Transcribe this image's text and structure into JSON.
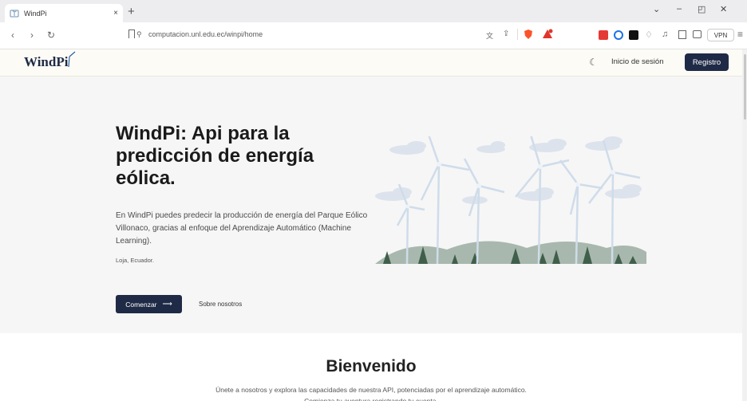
{
  "browser": {
    "tab_title": "WindPi",
    "tab_close": "×",
    "new_tab": "+",
    "url": "computacion.unl.edu.ec/winpi/home",
    "vpn_label": "VPN",
    "window_controls": {
      "dropdown": "⌄",
      "minimize": "–",
      "restore": "◰",
      "close": "✕"
    },
    "nav": {
      "back": "‹",
      "forward": "›",
      "reload": "↻"
    },
    "extension_colors": [
      "#e53935",
      "#1a73e8",
      "#111111"
    ]
  },
  "header": {
    "logo_text": "WindPi",
    "login_label": "Inicio de sesión",
    "register_label": "Registro"
  },
  "hero": {
    "title": "WindPi: Api para la predicción de energía eólica.",
    "description": "En WindPi puedes predecir la producción de energía del Parque Eólico Villonaco, gracias al enfoque del Aprendizaje Automático (Machine Learning).",
    "location": "Loja, Ecuador.",
    "start_button": "Comenzar",
    "start_arrow": "⟶",
    "about_link": "Sobre nosotros"
  },
  "welcome": {
    "title": "Bienvenido",
    "text": "Únete a nosotros y explora las capacidades de nuestra API, potenciadas por el aprendizaje automático. Comienza tu aventura registrando tu cuenta."
  },
  "colors": {
    "brand_dark": "#1f2b46",
    "hero_bg": "#f6f6f6",
    "header_bg": "#fcfbf6"
  }
}
